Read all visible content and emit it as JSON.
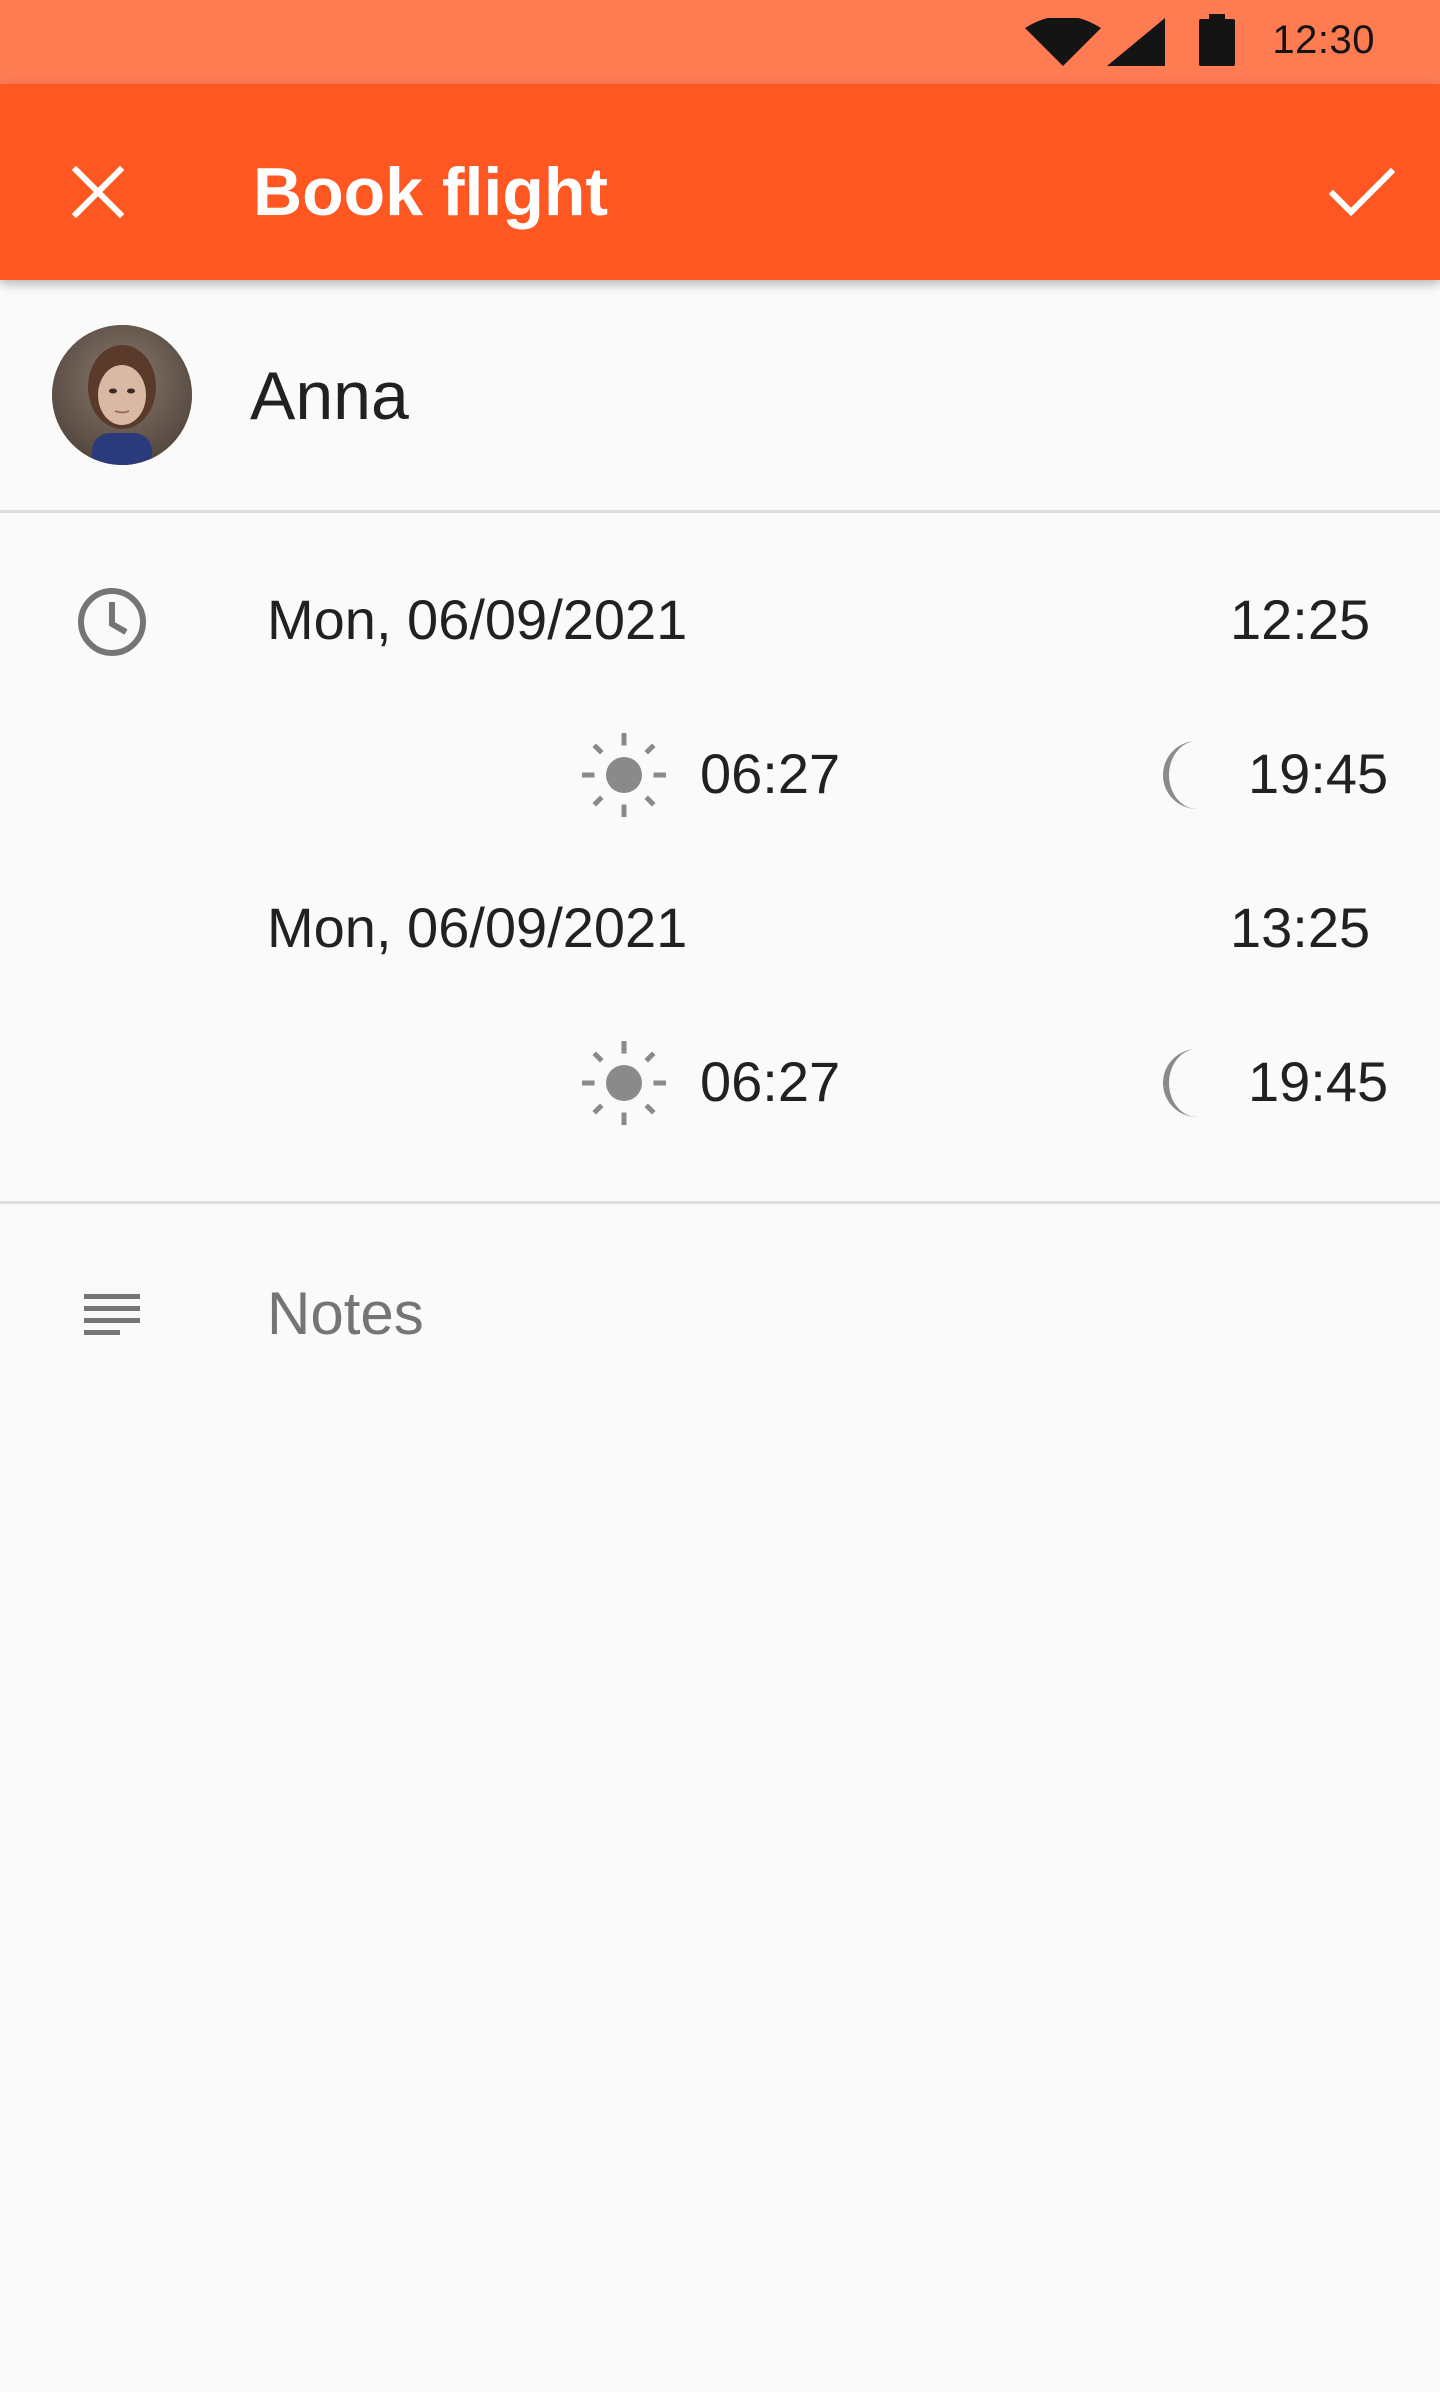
{
  "status_bar": {
    "time": "12:30",
    "icons": [
      "wifi-icon",
      "cellular-signal-icon",
      "battery-icon"
    ]
  },
  "app_bar": {
    "title": "Book flight",
    "close_icon": "close-icon",
    "confirm_icon": "check-icon",
    "background_color": "#ff5722",
    "status_color": "#ff7b52"
  },
  "person": {
    "name": "Anna",
    "avatar_icon": "avatar"
  },
  "schedule": {
    "rows": [
      {
        "date": "Mon, 06/09/2021",
        "time": "12:25",
        "sunrise": "06:27",
        "sunset": "19:45"
      },
      {
        "date": "Mon, 06/09/2021",
        "time": "13:25",
        "sunrise": "06:27",
        "sunset": "19:45"
      }
    ]
  },
  "notes": {
    "placeholder": "Notes"
  }
}
